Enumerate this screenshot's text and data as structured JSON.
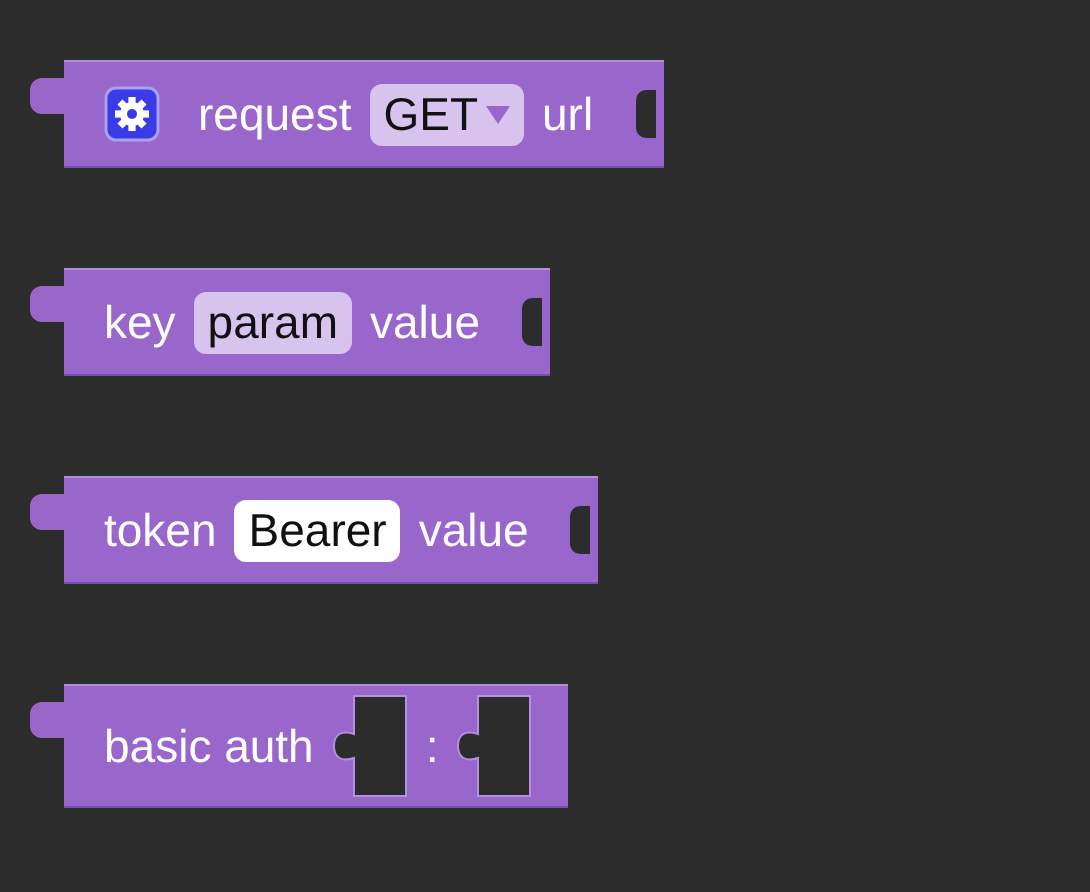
{
  "blocks": [
    {
      "value_input": true,
      "parts": [
        {
          "kind": "gear"
        },
        {
          "kind": "label",
          "text": "request"
        },
        {
          "kind": "dropdown",
          "text": "GET"
        },
        {
          "kind": "label",
          "text": "url"
        }
      ]
    },
    {
      "value_input": true,
      "parts": [
        {
          "kind": "label",
          "text": "key"
        },
        {
          "kind": "field",
          "text": "param"
        },
        {
          "kind": "label",
          "text": "value"
        }
      ]
    },
    {
      "value_input": true,
      "parts": [
        {
          "kind": "label",
          "text": "token"
        },
        {
          "kind": "text_input",
          "text": "Bearer"
        },
        {
          "kind": "label",
          "text": "value"
        }
      ]
    },
    {
      "value_input": false,
      "parts": [
        {
          "kind": "label",
          "text": "basic auth"
        },
        {
          "kind": "slot"
        },
        {
          "kind": "label",
          "text": ":"
        },
        {
          "kind": "slot"
        }
      ]
    }
  ]
}
